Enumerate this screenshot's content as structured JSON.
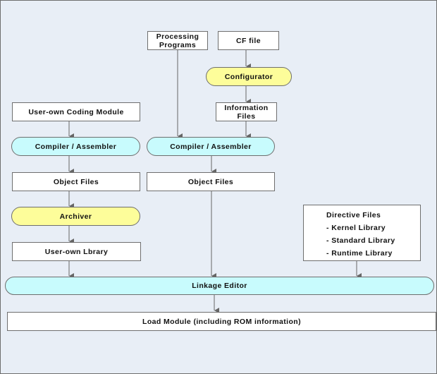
{
  "diagram": {
    "nodes": {
      "processing_programs": {
        "label": "Processing Programs",
        "line1": "Processing",
        "line2": "Programs"
      },
      "cf_file": {
        "label": "CF file"
      },
      "configurator": {
        "label": "Configurator"
      },
      "information_files": {
        "label": "Information Files",
        "line1": "Information",
        "line2": "Files"
      },
      "user_coding_module": {
        "label": "User-own Coding Module"
      },
      "compiler_left": {
        "label": "Compiler / Assembler"
      },
      "compiler_right": {
        "label": "Compiler / Assembler"
      },
      "object_files_left": {
        "label": "Object Files"
      },
      "object_files_right": {
        "label": "Object Files"
      },
      "archiver": {
        "label": "Archiver"
      },
      "user_library": {
        "label": "User-own Lbrary"
      },
      "directive_files": {
        "title": "Directive Files",
        "items": [
          "- Kernel Library",
          "- Standard Library",
          "- Runtime Library"
        ]
      },
      "linkage_editor": {
        "label": "Linkage Editor"
      },
      "load_module": {
        "label": "Load Module (including ROM information)"
      }
    },
    "edges": [
      [
        "cf_file",
        "configurator"
      ],
      [
        "configurator",
        "information_files"
      ],
      [
        "information_files",
        "compiler_right"
      ],
      [
        "processing_programs",
        "compiler_right"
      ],
      [
        "user_coding_module",
        "compiler_left"
      ],
      [
        "compiler_left",
        "object_files_left"
      ],
      [
        "object_files_left",
        "archiver"
      ],
      [
        "archiver",
        "user_library"
      ],
      [
        "user_library",
        "linkage_editor"
      ],
      [
        "compiler_right",
        "object_files_right"
      ],
      [
        "object_files_right",
        "linkage_editor"
      ],
      [
        "directive_files",
        "linkage_editor"
      ],
      [
        "linkage_editor",
        "load_module"
      ]
    ],
    "colors": {
      "process_cyan": "#c8fbfd",
      "process_yellow": "#fdfd9a",
      "file_white": "#ffffff",
      "background": "#e8eef6"
    }
  }
}
